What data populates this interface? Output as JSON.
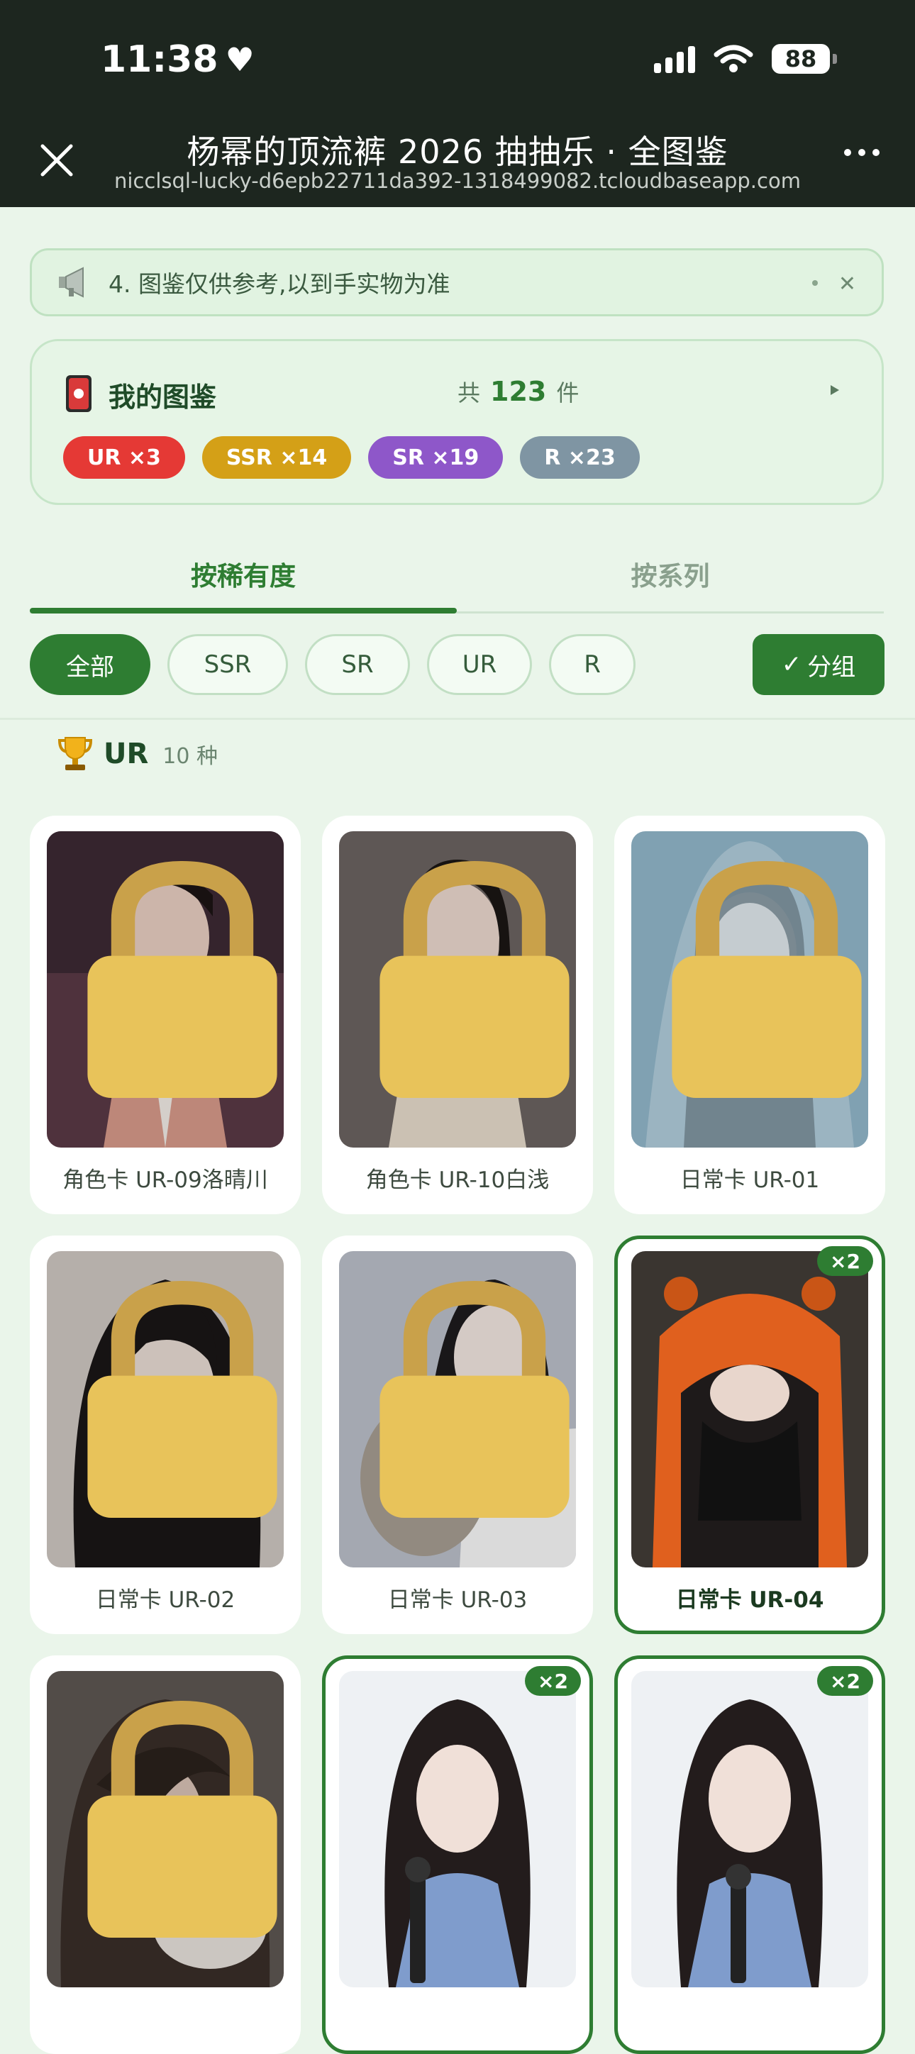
{
  "status_bar": {
    "time": "11:38",
    "battery": "88"
  },
  "header": {
    "title": "杨幂的顶流裤 2026 抽抽乐 · 全图鉴",
    "url": "nicclsql-lucky-d6epb22711da392-1318499082.tcloudbaseapp.com"
  },
  "notice": {
    "text": "4. 图鉴仅供参考,以到手实物为准"
  },
  "summary": {
    "title": "我的图鉴",
    "total_prefix": "共",
    "total": "123",
    "total_suffix": "件",
    "pills": [
      {
        "label": "UR ×3",
        "color": "#e53935"
      },
      {
        "label": "SSR ×14",
        "color": "#d4a017"
      },
      {
        "label": "SR ×19",
        "color": "#8e57c9"
      },
      {
        "label": "R ×23",
        "color": "#7f95a3"
      }
    ]
  },
  "tabs": [
    {
      "label": "按稀有度",
      "active": true
    },
    {
      "label": "按系列",
      "active": false
    }
  ],
  "filters": [
    "全部",
    "SSR",
    "SR",
    "UR",
    "R"
  ],
  "group_button": {
    "label": "分组"
  },
  "section": {
    "title": "UR",
    "count": "10 种"
  },
  "cards": [
    {
      "label": "角色卡 UR-09洛晴川",
      "owned": false,
      "count": ""
    },
    {
      "label": "角色卡 UR-10白浅",
      "owned": false,
      "count": ""
    },
    {
      "label": "日常卡 UR-01",
      "owned": false,
      "count": ""
    },
    {
      "label": "日常卡 UR-02",
      "owned": false,
      "count": ""
    },
    {
      "label": "日常卡 UR-03",
      "owned": false,
      "count": ""
    },
    {
      "label": "日常卡 UR-04",
      "owned": true,
      "count": "×2"
    },
    {
      "label": "",
      "owned": false,
      "count": ""
    },
    {
      "label": "",
      "owned": true,
      "count": "×2"
    },
    {
      "label": "",
      "owned": true,
      "count": "×2"
    }
  ],
  "colors": {
    "accent": "#2e7d32",
    "background": "#eaf5ea"
  }
}
